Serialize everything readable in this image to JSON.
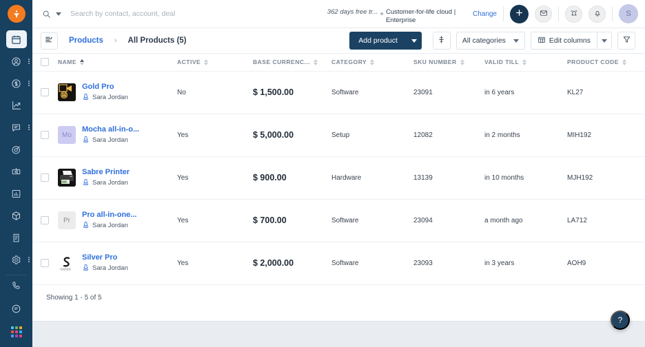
{
  "sidebar": {
    "logo": "app-logo",
    "items": [
      {
        "name": "calendar",
        "icon": "calendar-icon",
        "active": true,
        "dots": false
      },
      {
        "name": "contacts",
        "icon": "user-circle-icon",
        "active": false,
        "dots": true
      },
      {
        "name": "deals",
        "icon": "dollar-circle-icon",
        "active": false,
        "dots": true
      },
      {
        "name": "analytics",
        "icon": "trending-up-icon",
        "active": false,
        "dots": false
      },
      {
        "name": "conversations",
        "icon": "chat-icon",
        "active": false,
        "dots": true
      },
      {
        "name": "goals",
        "icon": "target-icon",
        "active": false,
        "dots": false
      },
      {
        "name": "campaigns",
        "icon": "megaphone-box-icon",
        "active": false,
        "dots": false
      },
      {
        "name": "reports",
        "icon": "bar-chart-icon",
        "active": false,
        "dots": false
      },
      {
        "name": "products",
        "icon": "cube-icon",
        "active": false,
        "dots": false
      },
      {
        "name": "documents",
        "icon": "document-icon",
        "active": false,
        "dots": false
      },
      {
        "name": "settings",
        "icon": "gear-icon",
        "active": false,
        "dots": true
      }
    ],
    "bottom_items": [
      {
        "name": "phone",
        "icon": "phone-icon"
      },
      {
        "name": "notes",
        "icon": "note-icon"
      },
      {
        "name": "apps",
        "icon": "apps-grid-icon"
      }
    ]
  },
  "header": {
    "search_placeholder": "Search by contact, account, deal",
    "search_value": "",
    "trial_text": "362 days free tr...",
    "cloud_text": "Customer-for-life cloud | Enterprise",
    "change_label": "Change",
    "add_icon": "plus-icon",
    "mail_icon": "envelope-icon",
    "alarm_icon": "alarm-clock-icon",
    "bell_icon": "bell-icon",
    "avatar_initial": "S"
  },
  "toolbar": {
    "list_toggle_icon": "list-view-icon",
    "breadcrumb_parent": "Products",
    "breadcrumb_sep": "›",
    "breadcrumb_current": "All Products (5)",
    "add_product_label": "Add product",
    "settings_icon": "sliders-icon",
    "category_filter": "All categories",
    "edit_columns_label": "Edit columns",
    "edit_columns_icon": "table-icon",
    "filter_icon": "funnel-icon"
  },
  "table": {
    "columns": [
      {
        "key": "name",
        "label": "NAME",
        "sorted": true
      },
      {
        "key": "active",
        "label": "ACTIVE",
        "sorted": false
      },
      {
        "key": "price",
        "label": "BASE CURRENC...",
        "sorted": false
      },
      {
        "key": "category",
        "label": "CATEGORY",
        "sorted": false
      },
      {
        "key": "sku",
        "label": "SKU NUMBER",
        "sorted": false
      },
      {
        "key": "valid",
        "label": "VALID TILL",
        "sorted": false
      },
      {
        "key": "code",
        "label": "PRODUCT CODE",
        "sorted": false
      }
    ],
    "rows": [
      {
        "name": "Gold Pro",
        "owner": "Sara Jordan",
        "active": "No",
        "price": "$ 1,500.00",
        "category": "Software",
        "sku": "23091",
        "valid": "in 6 years",
        "code": "KL27",
        "thumb_type": "image-dark-robot",
        "thumb_text": "",
        "thumb_bg": "#171410",
        "thumb_fg": "#e8b84b"
      },
      {
        "name": "Mocha all-in-o...",
        "owner": "Sara Jordan",
        "active": "Yes",
        "price": "$ 5,000.00",
        "category": "Setup",
        "sku": "12082",
        "valid": "in 2 months",
        "code": "MIH192",
        "thumb_type": "initials",
        "thumb_text": "Mo",
        "thumb_bg": "#ccccf2",
        "thumb_fg": "#8a8ad0"
      },
      {
        "name": "Sabre Printer",
        "owner": "Sara Jordan",
        "active": "Yes",
        "price": "$ 900.00",
        "category": "Hardware",
        "sku": "13139",
        "valid": "in 10 months",
        "code": "MJH192",
        "thumb_type": "image-printer",
        "thumb_text": "",
        "thumb_bg": "#1a1a1a",
        "thumb_fg": "#ffffff"
      },
      {
        "name": "Pro all-in-one...",
        "owner": "Sara Jordan",
        "active": "Yes",
        "price": "$ 700.00",
        "category": "Software",
        "sku": "23094",
        "valid": "a month ago",
        "code": "LA712",
        "thumb_type": "initials",
        "thumb_text": "Pr",
        "thumb_bg": "#ececec",
        "thumb_fg": "#8c8c8c"
      },
      {
        "name": "Silver Pro",
        "owner": "Sara Jordan",
        "active": "Yes",
        "price": "$ 2,000.00",
        "category": "Software",
        "sku": "23093",
        "valid": "in 3 years",
        "code": "AOH9",
        "thumb_type": "image-s-mark",
        "thumb_text": "",
        "thumb_bg": "#ffffff",
        "thumb_fg": "#222222"
      }
    ]
  },
  "footer": {
    "showing_text": "Showing 1 - 5 of 5",
    "help_label": "?"
  },
  "colors": {
    "rail_bg": "#18405f",
    "accent_orange": "#f47b20",
    "link_blue": "#2f6fdc",
    "primary_dark": "#1b4263",
    "page_bottom": "#e9edf2"
  }
}
